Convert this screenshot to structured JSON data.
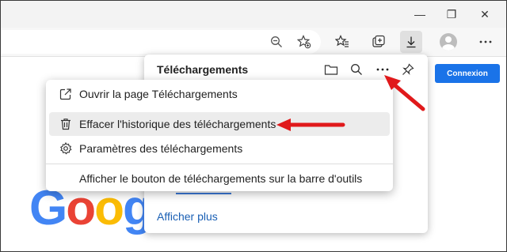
{
  "window": {
    "minimize_glyph": "—",
    "maximize_glyph": "❐",
    "close_glyph": "✕"
  },
  "toolbar": {
    "icons": [
      "zoom-out-icon",
      "add-favorite-icon",
      "favorites-icon",
      "collections-icon",
      "downloads-icon",
      "profile-icon",
      "more-icon"
    ]
  },
  "page": {
    "signin_label": "Connexion",
    "logo_text": [
      "G",
      "o",
      "o",
      "g"
    ]
  },
  "downloads_panel": {
    "title": "Téléchargements",
    "show_more": "Afficher plus"
  },
  "context_menu": {
    "items": [
      {
        "label": "Ouvrir la page Téléchargements",
        "icon": "external-link-icon"
      },
      {
        "label": "Effacer l'historique des téléchargements",
        "icon": "trash-icon",
        "highlighted": true
      },
      {
        "label": "Paramètres des téléchargements",
        "icon": "gear-icon"
      },
      {
        "label": "Afficher le bouton de téléchargements sur la barre d'outils",
        "icon": ""
      }
    ]
  },
  "colors": {
    "accent": "#1a73e8",
    "arrow": "#e0191b"
  }
}
